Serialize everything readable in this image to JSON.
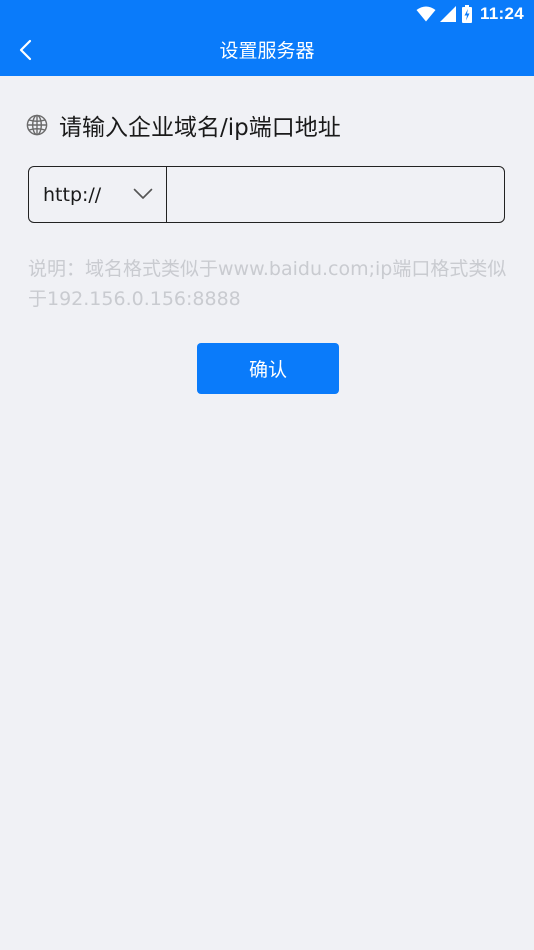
{
  "status_bar": {
    "time": "11:24",
    "icons": [
      "wifi-icon",
      "cell-signal-icon",
      "battery-charging-icon"
    ]
  },
  "header": {
    "title": "设置服务器",
    "back_icon": "chevron-left-icon"
  },
  "form": {
    "prompt_icon": "globe-icon",
    "prompt": "请输入企业域名/ip端口地址",
    "protocol_selected": "http://",
    "address_value": "",
    "address_placeholder": "",
    "note": "说明：域名格式类似于www.baidu.com;ip端口格式类似于192.156.0.156:8888",
    "confirm_label": "确认"
  },
  "colors": {
    "primary": "#0a7bfa",
    "background": "#f0f1f5",
    "hint_text": "#c9cbd0"
  }
}
